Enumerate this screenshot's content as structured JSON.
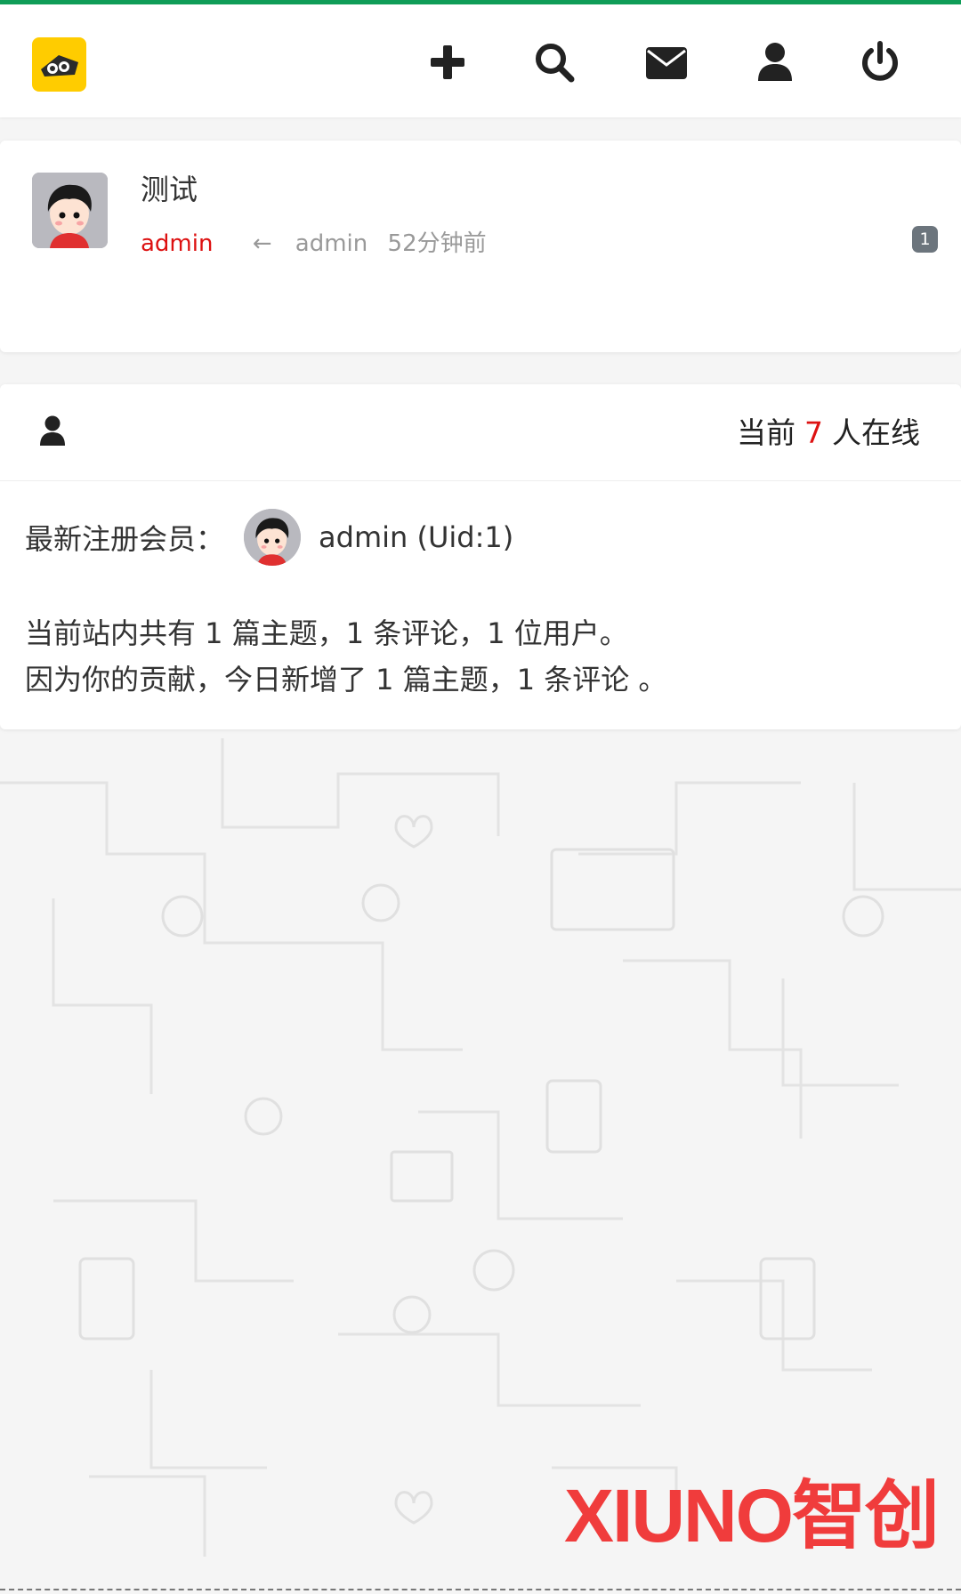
{
  "theme": {
    "accent_green": "#0f9d58",
    "author_red": "#dd1111",
    "badge_gray": "#6c757d",
    "watermark_red": "#f03c3c"
  },
  "header": {
    "logo_icon": "owl-logo-icon",
    "actions": [
      {
        "icon": "plus-icon",
        "label": "new-thread"
      },
      {
        "icon": "search-icon",
        "label": "search"
      },
      {
        "icon": "envelope-icon",
        "label": "messages"
      },
      {
        "icon": "user-icon",
        "label": "profile"
      },
      {
        "icon": "power-icon",
        "label": "logout"
      }
    ]
  },
  "thread": {
    "title": "测试",
    "author": "admin",
    "arrow": "←",
    "last_poster": "admin",
    "time": "52分钟前",
    "reply_count": "1"
  },
  "stats": {
    "online_prefix": "当前",
    "online_count": "7",
    "online_suffix": "人在线",
    "newest_label": "最新注册会员：",
    "newest_user": "admin (Uid:1)",
    "line1": "当前站内共有 1 篇主题，1 条评论，1 位用户。",
    "line2": "因为你的贡献，今日新增了 1 篇主题，1 条评论 。"
  },
  "watermark": "XIUNO智创"
}
